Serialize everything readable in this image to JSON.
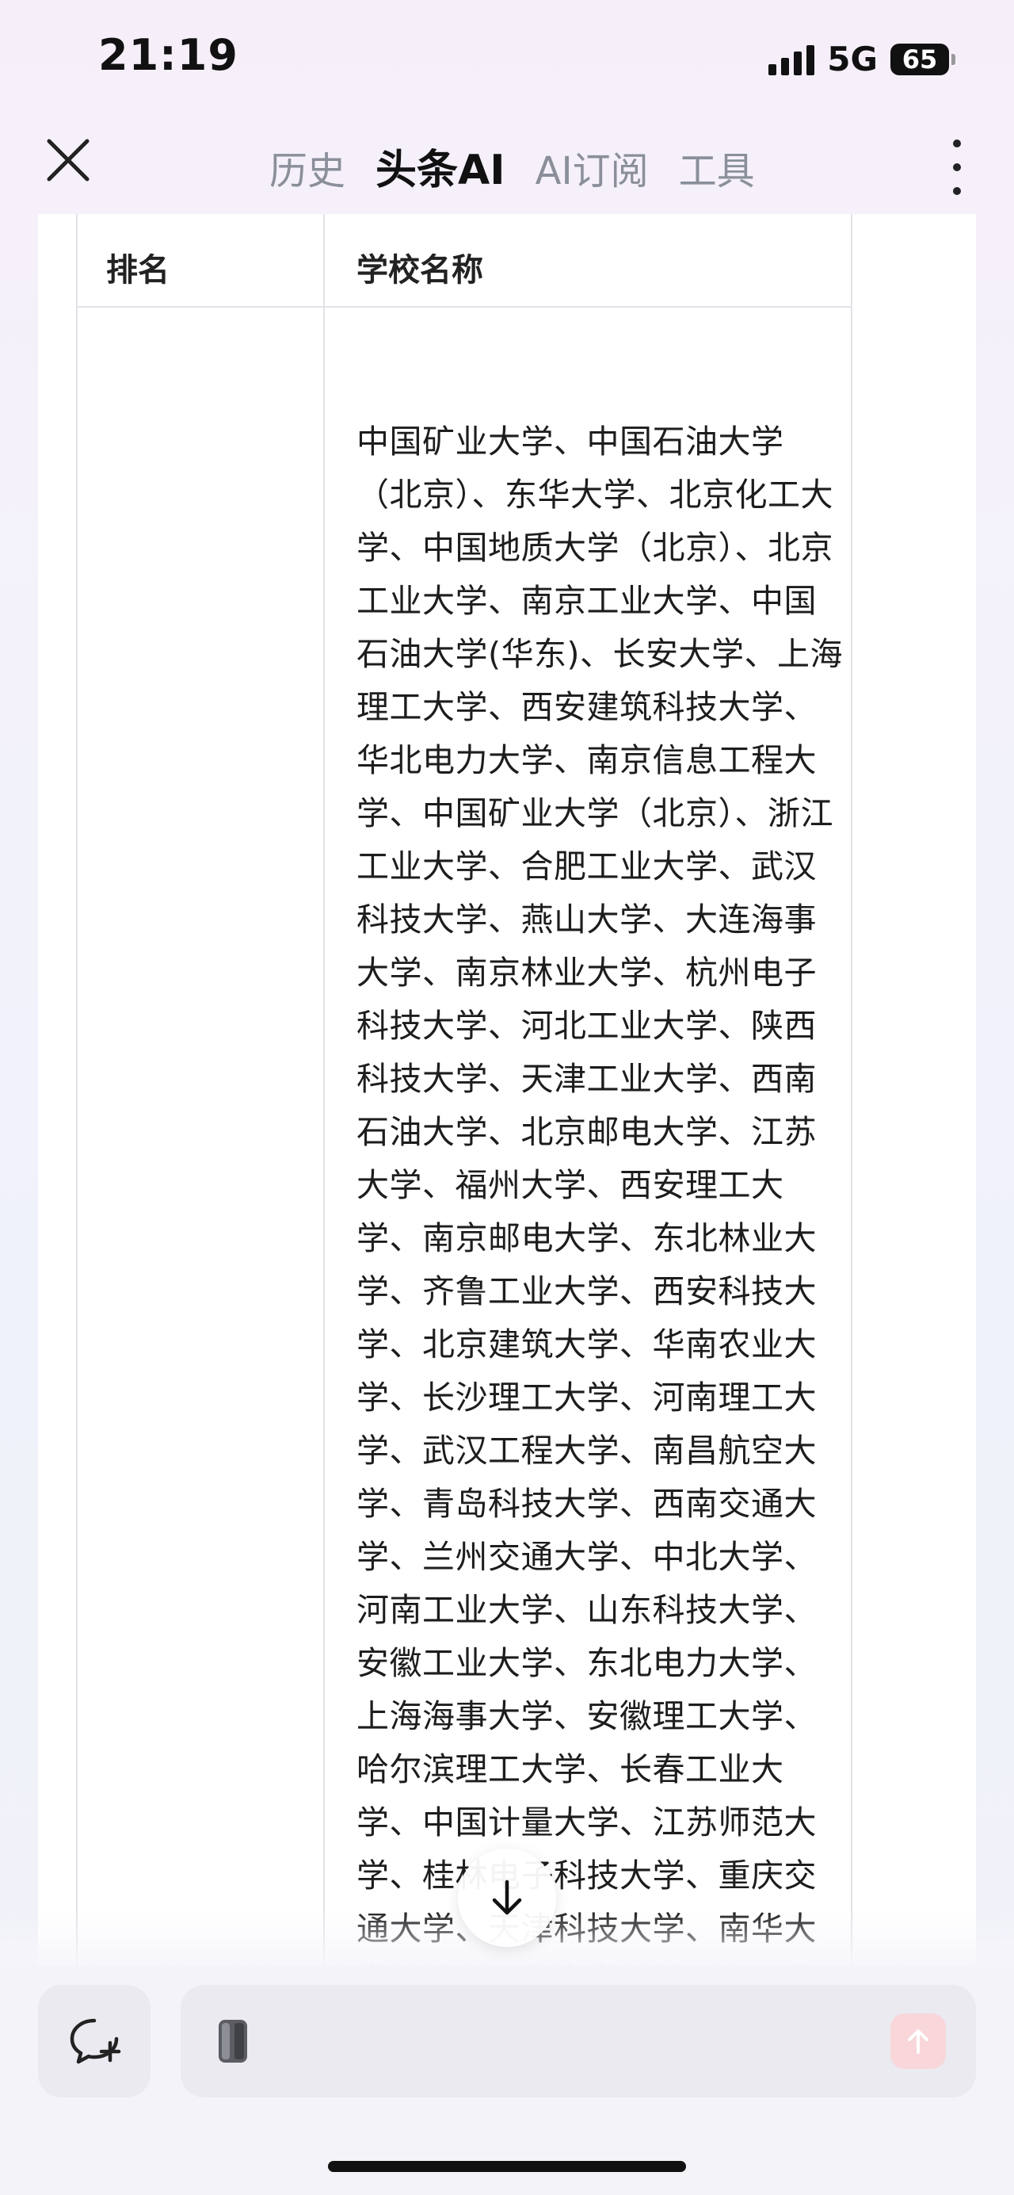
{
  "status_bar": {
    "time": "21:19",
    "network": "5G",
    "battery": "65"
  },
  "nav": {
    "tabs": [
      {
        "label": "历史",
        "active": false
      },
      {
        "label": "头条AI",
        "active": true
      },
      {
        "label": "AI订阅",
        "active": false
      },
      {
        "label": "工具",
        "active": false
      }
    ]
  },
  "table": {
    "headers": {
      "rank": "排名",
      "school": "学校名称"
    },
    "row": {
      "rank": "",
      "schools": "中国矿业大学、中国石油大学（北京）、东华大学、北京化工大学、中国地质大学（北京）、北京工业大学、南京工业大学、中国石油大学(华东)、长安大学、上海理工大学、西安建筑科技大学、华北电力大学、南京信息工程大学、中国矿业大学（北京）、浙江工业大学、合肥工业大学、武汉科技大学、燕山大学、大连海事大学、南京林业大学、杭州电子科技大学、河北工业大学、陕西科技大学、天津工业大学、西南石油大学、北京邮电大学、江苏大学、福州大学、西安理工大学、南京邮电大学、东北林业大学、齐鲁工业大学、西安科技大学、北京建筑大学、华南农业大学、长沙理工大学、河南理工大学、武汉工程大学、南昌航空大学、青岛科技大学、西南交通大学、兰州交通大学、中北大学、河南工业大学、山东科技大学、安徽工业大学、东北电力大学、上海海事大学、安徽理工大学、哈尔滨理工大学、长春工业大学、中国计量大学、江苏师范大学、桂林电子科技大学、重庆交通大学、天津科技大学、南华大学、沈阳工业大学、兰州理工大学、北京信息科技大学"
    }
  },
  "bottom": {
    "input_placeholder": "",
    "colors": {
      "send_button": "#f8d6d9",
      "accent": "#f05a6a"
    }
  }
}
